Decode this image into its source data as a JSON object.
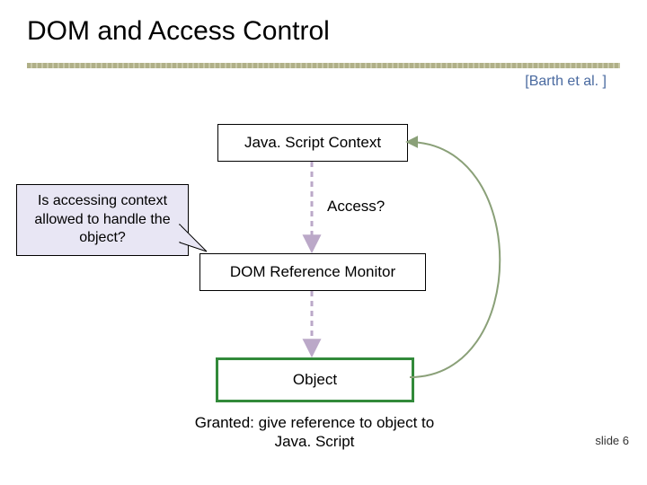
{
  "title": "DOM and Access Control",
  "citation": "[Barth et al. ]",
  "boxes": {
    "js_context": "Java. Script Context",
    "ref_monitor": "DOM Reference Monitor",
    "object": "Object"
  },
  "callout": "Is accessing context allowed to handle the object?",
  "labels": {
    "access": "Access?",
    "granted": "Granted: give reference to object to Java. Script"
  },
  "footer": {
    "slide": "slide 6"
  },
  "colors": {
    "citation": "#4a6aa0",
    "object_border": "#328a3a",
    "callout_bg": "#e8e6f4",
    "dashed_arrow": "#bba8c8",
    "return_arrow": "#8aa078"
  }
}
